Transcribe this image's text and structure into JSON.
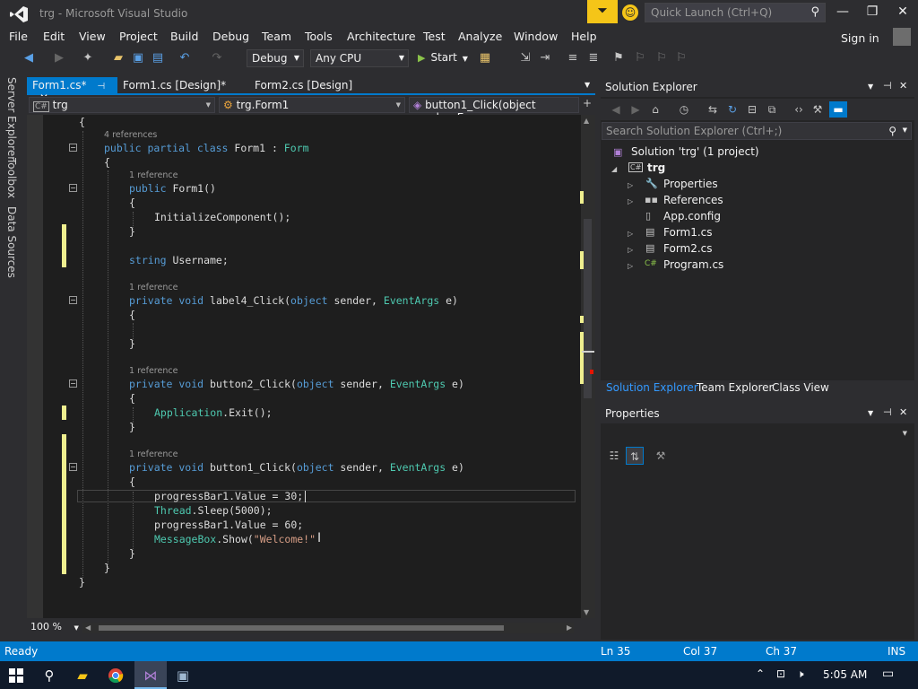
{
  "window": {
    "title": "trg - Microsoft Visual Studio",
    "quick_launch_placeholder": "Quick Launch (Ctrl+Q)",
    "accent": "#007acc"
  },
  "menu": [
    "File",
    "Edit",
    "View",
    "Project",
    "Build",
    "Debug",
    "Team",
    "Tools",
    "Architecture",
    "Test",
    "Analyze",
    "Window",
    "Help"
  ],
  "account": {
    "signin": "Sign in"
  },
  "toolbar": {
    "config": "Debug",
    "platform": "Any CPU",
    "start_label": "Start"
  },
  "side_tabs": [
    "Server Explorer",
    "Toolbox",
    "Data Sources"
  ],
  "doc_tabs": [
    {
      "label": "Form1.cs*",
      "active": true
    },
    {
      "label": "Form1.cs [Design]*",
      "active": false
    },
    {
      "label": "Form2.cs [Design]",
      "active": false
    }
  ],
  "navbar": {
    "project": "trg",
    "class": "trg.Form1",
    "member": "button1_Click(object sender, Eve"
  },
  "editor": {
    "zoom": "100 %",
    "codelens": [
      "4 references",
      "1 reference",
      "1 reference",
      "1 reference",
      "1 reference"
    ],
    "lines": {
      "l1": "{",
      "l2_kw": "public partial class",
      "l2_name": " Form1 : ",
      "l2_type": "Form",
      "l3": "{",
      "l4_kw": "public",
      "l4_rest": " Form1()",
      "l5": "{",
      "l6": "InitializeComponent();",
      "l7": "}",
      "l8_kw": "string",
      "l8_rest": " Username;",
      "l9_kw": "private void",
      "l9_a": " label4_Click(",
      "l9_kw2": "object",
      "l9_b": " sender, ",
      "l9_type": "EventArgs",
      "l9_c": " e)",
      "l10": "{",
      "l11": "}",
      "l12_kw": "private void",
      "l12_a": " button2_Click(",
      "l12_kw2": "object",
      "l12_b": " sender, ",
      "l12_type": "EventArgs",
      "l12_c": " e)",
      "l13": "{",
      "l14_type": "Application",
      "l14_rest": ".Exit();",
      "l15": "}",
      "l16_kw": "private void",
      "l16_a": " button1_Click(",
      "l16_kw2": "object",
      "l16_b": " sender, ",
      "l16_type": "EventArgs",
      "l16_c": " e)",
      "l17": "{",
      "l18": "progressBar1.Value = 30;",
      "l19_type": "Thread",
      "l19_rest": ".Sleep(5000);",
      "l20": "progressBar1.Value = 60;",
      "l21_type": "MessageBox",
      "l21_a": ".Show(",
      "l21_str": "\"Welcome!\"",
      "l22": "}",
      "l23": "}",
      "l24": "}"
    }
  },
  "solution_explorer": {
    "title": "Solution Explorer",
    "search_placeholder": "Search Solution Explorer (Ctrl+;)",
    "solution": "Solution 'trg' (1 project)",
    "project": "trg",
    "items": [
      "Properties",
      "References",
      "App.config",
      "Form1.cs",
      "Form2.cs",
      "Program.cs"
    ],
    "tabs": [
      "Solution Explorer",
      "Team Explorer",
      "Class View"
    ]
  },
  "properties": {
    "title": "Properties"
  },
  "status": {
    "state": "Ready",
    "ln": "Ln 35",
    "col": "Col 37",
    "ch": "Ch 37",
    "mode": "INS"
  },
  "taskbar": {
    "time": "5:05 AM"
  }
}
